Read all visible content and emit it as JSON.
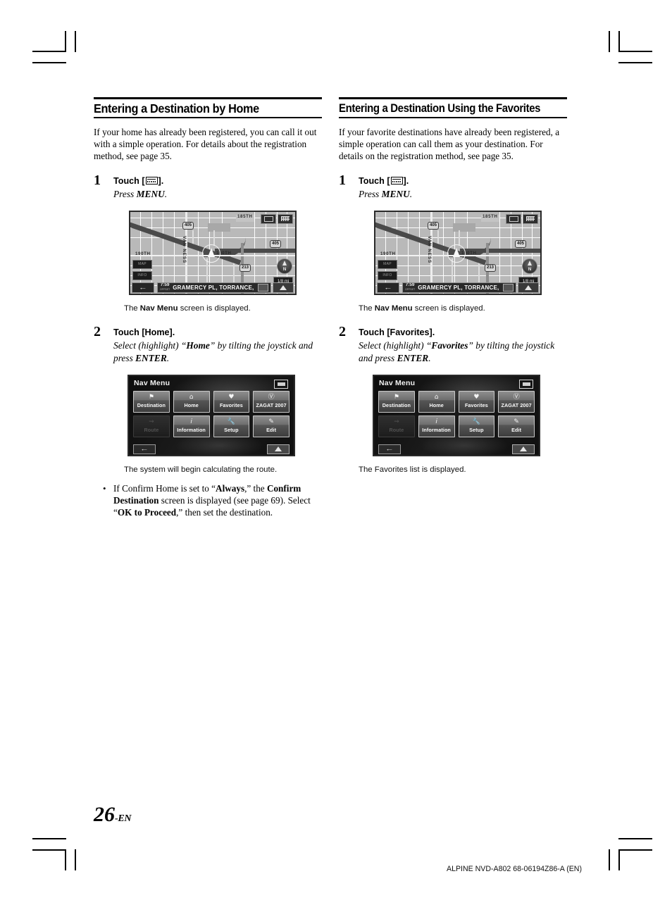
{
  "page": {
    "number": "26",
    "lang_suffix": "-EN",
    "footer_code": "ALPINE NVD-A802 68-06194Z86-A (EN)"
  },
  "columns": [
    {
      "heading": "Entering a Destination by Home",
      "intro": "If your home has already been registered, you can call it out with a simple operation. For details about the registration method, see page 35.",
      "steps": [
        {
          "number": "1",
          "head_pre": "Touch [",
          "head_post": "].",
          "sub_plain_1": "Press ",
          "sub_bold": "MENU",
          "sub_plain_2": "."
        },
        {
          "number": "2",
          "head": "Touch [Home].",
          "sub_1": "Select (highlight) “",
          "sub_b1": "Home",
          "sub_2": "” by tilting the joystick and press ",
          "sub_b2": "ENTER",
          "sub_3": "."
        }
      ],
      "caption_after_step1_a": "The ",
      "caption_after_step1_b": "Nav Menu",
      "caption_after_step1_c": " screen is displayed.",
      "caption_after_step2": "The system will begin calculating the route.",
      "note": {
        "bullet": "•",
        "t1": "If Confirm Home is set to “",
        "b1": "Always",
        "t2": ",” the ",
        "b2": "Confirm Destination",
        "t3": " screen is displayed (see page 69). Select “",
        "b3": "OK to Proceed",
        "t4": ",” then set the destination."
      }
    },
    {
      "heading": "Entering a Destination Using the Favorites",
      "intro": "If your favorite destinations have already been registered, a simple operation can call them as your destination. For details on the registration method, see page 35.",
      "steps": [
        {
          "number": "1",
          "head_pre": "Touch [",
          "head_post": "].",
          "sub_plain_1": "Press ",
          "sub_bold": "MENU",
          "sub_plain_2": "."
        },
        {
          "number": "2",
          "head": "Touch [Favorites].",
          "sub_1": "Select (highlight) “",
          "sub_b1": "Favorites",
          "sub_2": "” by tilting the joystick and press ",
          "sub_b2": "ENTER",
          "sub_3": "."
        }
      ],
      "caption_after_step1_a": "The ",
      "caption_after_step1_b": "Nav Menu",
      "caption_after_step1_c": " screen is displayed.",
      "caption_after_step2": "The Favorites list is displayed."
    }
  ],
  "map_screen": {
    "labels": {
      "street_190th": "190TH",
      "street_190th_center": "190TH",
      "street_185th": "185TH",
      "street_vanness": "VAN NESS"
    },
    "shields": {
      "hwy_405_a": "405",
      "hwy_405_b": "405",
      "route_213": "213"
    },
    "status": {
      "time": "7:59",
      "time_sub": "OFFSET",
      "address": "GRAMERCY PL, TORRANCE,",
      "compass": "N",
      "scale": "1/8 mi"
    },
    "left_buttons": [
      "MAP",
      "INFO"
    ]
  },
  "nav_menu_screen": {
    "title": "Nav Menu",
    "buttons": [
      {
        "label": "Destination",
        "icon": "flag-icon",
        "glyph": "⚑",
        "disabled": false
      },
      {
        "label": "Home",
        "icon": "house-icon",
        "glyph": "⌂",
        "disabled": false
      },
      {
        "label": "Favorites",
        "icon": "heart-icon",
        "glyph": "♥",
        "disabled": false
      },
      {
        "label": "ZAGAT 2007",
        "icon": "zagat-icon",
        "glyph": "Ⓩ",
        "disabled": false
      },
      {
        "label": "Route",
        "icon": "route-icon",
        "glyph": "⤳",
        "disabled": true
      },
      {
        "label": "Information",
        "icon": "info-icon",
        "glyph": "i",
        "disabled": false
      },
      {
        "label": "Setup",
        "icon": "wrench-icon",
        "glyph": "ὒ7",
        "disabled": false
      },
      {
        "label": "Edit",
        "icon": "pencil-icon",
        "glyph": "✎",
        "disabled": false
      }
    ],
    "bottom": {
      "back_glyph": "↵",
      "up_glyph": "▲"
    }
  }
}
